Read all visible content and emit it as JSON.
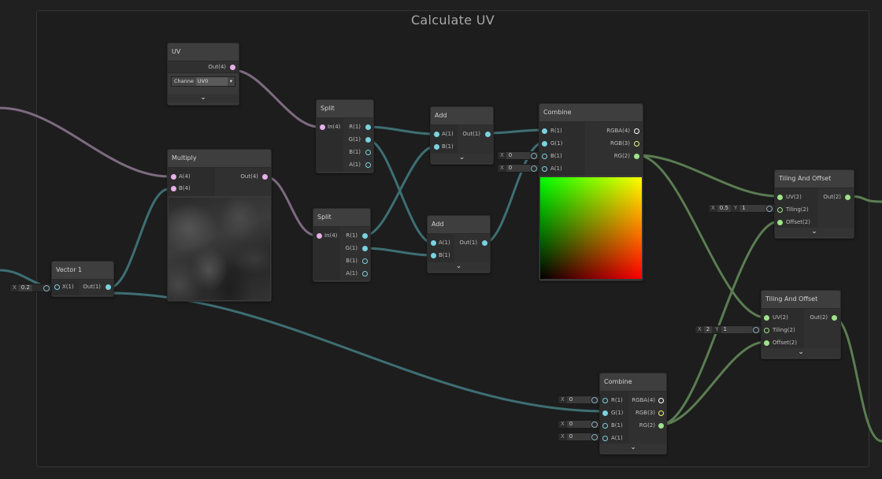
{
  "group": {
    "title": "Calculate UV"
  },
  "nodes": {
    "uv": {
      "title": "UV",
      "out": "Out(4)",
      "channel_label": "Channe",
      "channel_value": "UV0"
    },
    "multiply": {
      "title": "Multiply",
      "in_a": "A(4)",
      "in_b": "B(4)",
      "out": "Out(4)"
    },
    "vector1": {
      "title": "Vector 1",
      "in_x": "X(1)",
      "out": "Out(1)"
    },
    "split1": {
      "title": "Split",
      "in": "In(4)",
      "r": "R(1)",
      "g": "G(1)",
      "b": "B(1)",
      "a": "A(1)"
    },
    "split2": {
      "title": "Split",
      "in": "In(4)",
      "r": "R(1)",
      "g": "G(1)",
      "b": "B(1)",
      "a": "A(1)"
    },
    "add1": {
      "title": "Add",
      "in_a": "A(1)",
      "in_b": "B(1)",
      "out": "Out(1)"
    },
    "add2": {
      "title": "Add",
      "in_a": "A(1)",
      "in_b": "B(1)",
      "out": "Out(1)"
    },
    "combine1": {
      "title": "Combine",
      "r": "R(1)",
      "g": "G(1)",
      "b": "B(1)",
      "a": "A(1)",
      "rgba": "RGBA(4)",
      "rgb": "RGB(3)",
      "rg": "RG(2)"
    },
    "combine2": {
      "title": "Combine",
      "r": "R(1)",
      "g": "G(1)",
      "b": "B(1)",
      "a": "A(1)",
      "rgba": "RGBA(4)",
      "rgb": "RGB(3)",
      "rg": "RG(2)"
    },
    "tiling1": {
      "title": "Tiling And Offset",
      "uv": "UV(2)",
      "tiling": "Tiling(2)",
      "offset": "Offset(2)",
      "out": "Out(2)"
    },
    "tiling2": {
      "title": "Tiling And Offset",
      "uv": "UV(2)",
      "tiling": "Tiling(2)",
      "offset": "Offset(2)",
      "out": "Out(2)"
    }
  },
  "fields": {
    "vector1_x": {
      "label": "X",
      "value": "0.2"
    },
    "combine1_b": {
      "label": "X",
      "value": "0"
    },
    "combine1_a": {
      "label": "X",
      "value": "0"
    },
    "tiling1_tiling": {
      "x_label": "X",
      "x_value": "0.5",
      "y_label": "Y",
      "y_value": "1"
    },
    "tiling2_tiling": {
      "x_label": "X",
      "x_value": "2",
      "y_label": "Y",
      "y_value": "1"
    },
    "combine2_r": {
      "label": "X",
      "value": "0"
    },
    "combine2_b": {
      "label": "X",
      "value": "0"
    },
    "combine2_a": {
      "label": "X",
      "value": "0"
    }
  },
  "chevron": "⌄",
  "colors": {
    "wire_vec4": "#7d6a80",
    "wire_vec1": "#3e6f73",
    "wire_vec2": "#5b7d52",
    "port_vec4": "#e8b0e8",
    "port_vec1": "#79d3e0",
    "port_vec2": "#9ee28a",
    "port_vec3": "#f0f07a"
  }
}
